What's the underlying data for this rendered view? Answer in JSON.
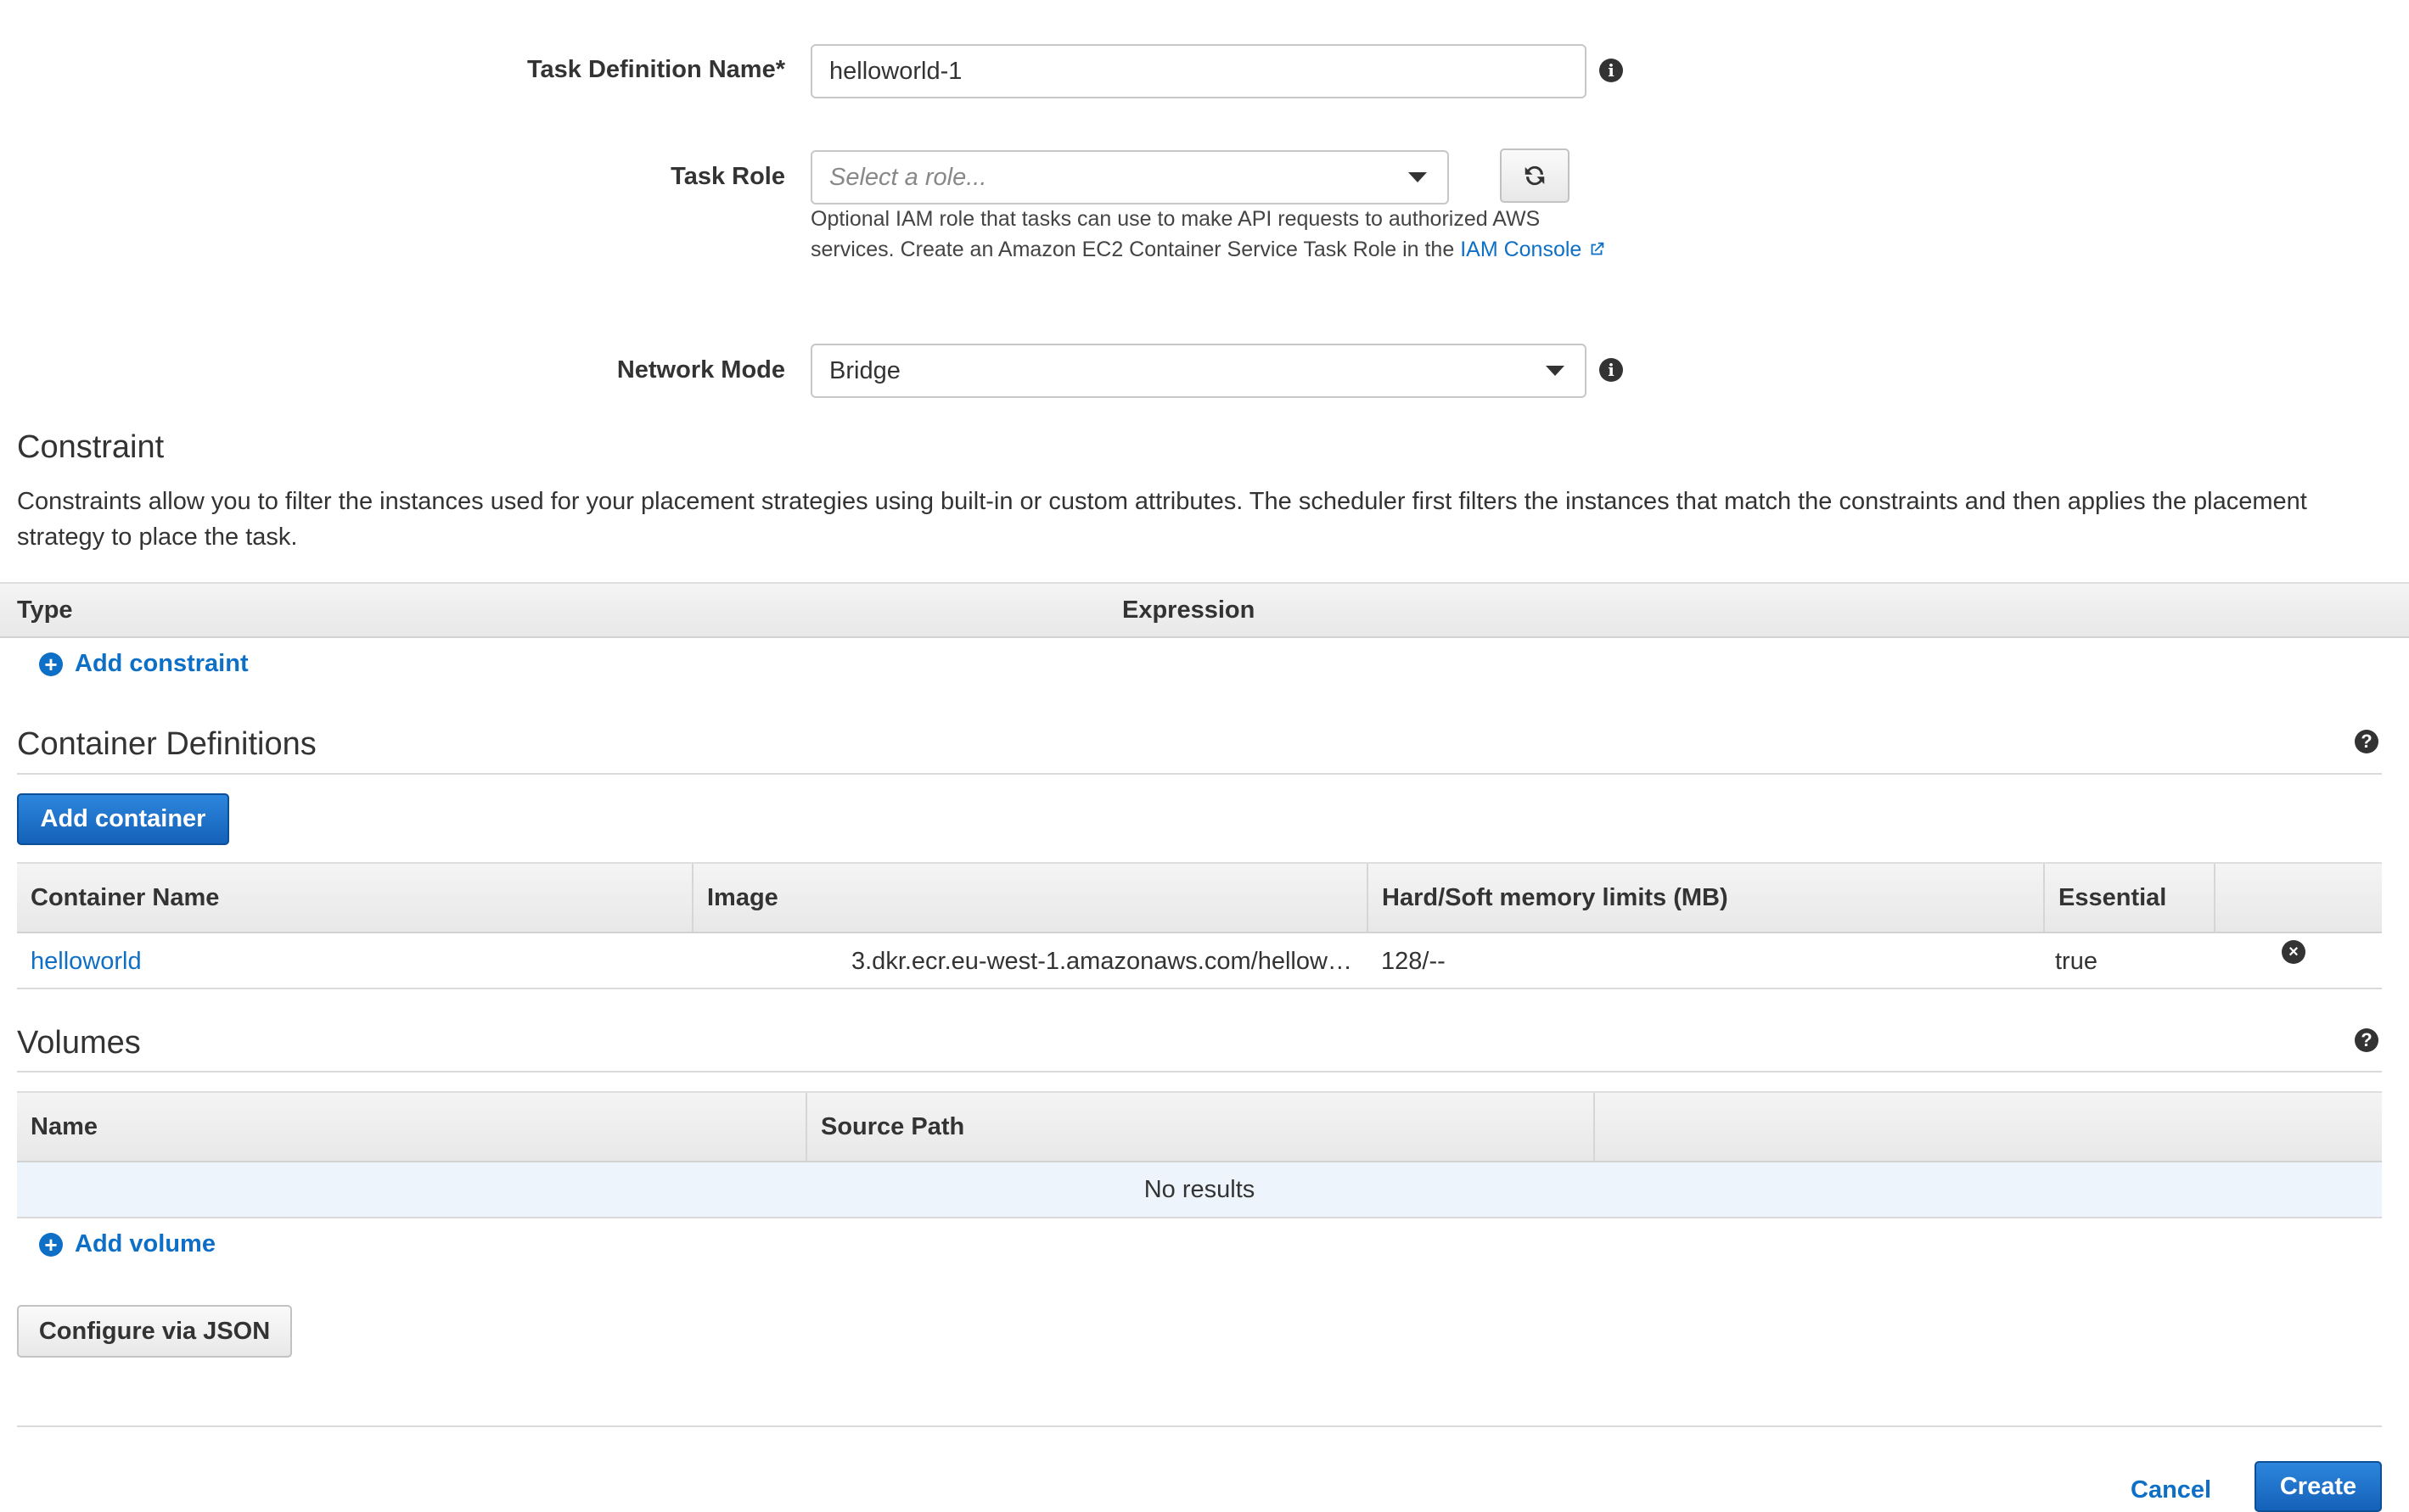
{
  "form": {
    "task_definition_name": {
      "label": "Task Definition Name*",
      "value": "helloworld-1",
      "info_icon": "info-icon"
    },
    "task_role": {
      "label": "Task Role",
      "placeholder": "Select a role...",
      "refresh_icon": "refresh-icon",
      "help_line1": "Optional IAM role that tasks can use to make API requests to authorized AWS",
      "help_line2_prefix": "services. Create an Amazon EC2 Container Service Task Role in the",
      "help_link": "IAM Console",
      "external_icon": "external-link-icon"
    },
    "network_mode": {
      "label": "Network Mode",
      "value": "Bridge",
      "info_icon": "info-icon"
    }
  },
  "constraint": {
    "title": "Constraint",
    "description": "Constraints allow you to filter the instances used for your placement strategies using built-in or custom attributes. The scheduler first filters the instances that match the constraints and then applies the placement strategy to place the task.",
    "columns": [
      "Type",
      "Expression"
    ],
    "add_label": "Add constraint"
  },
  "containers": {
    "title": "Container Definitions",
    "add_button": "Add container",
    "columns": [
      "Container Name",
      "Image",
      "Hard/Soft memory limits (MB)",
      "Essential"
    ],
    "rows": [
      {
        "name": "helloworld",
        "image": "3.dkr.ecr.eu-west-1.amazonaws.com/hellow…",
        "memory": "128/--",
        "essential": "true"
      }
    ]
  },
  "volumes": {
    "title": "Volumes",
    "columns": [
      "Name",
      "Source Path"
    ],
    "empty": "No results",
    "add_label": "Add volume"
  },
  "configure_json_button": "Configure via JSON",
  "footer": {
    "cancel": "Cancel",
    "create": "Create"
  },
  "colors": {
    "link": "#0e6fc7",
    "primary": "#1a6fd0"
  }
}
